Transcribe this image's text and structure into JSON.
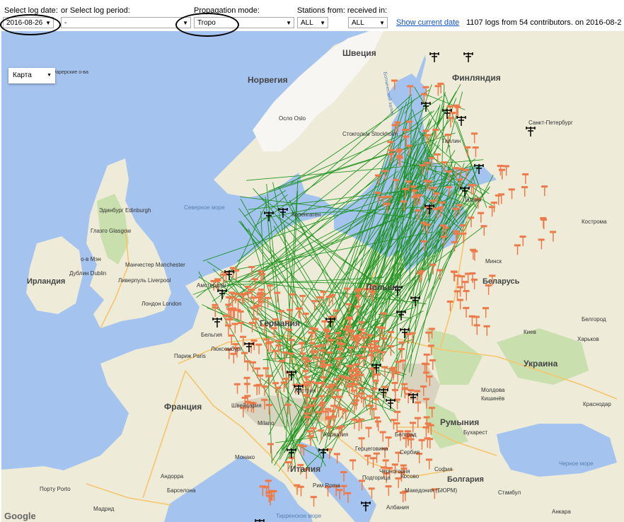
{
  "toolbar": {
    "log_date_label": "Select log date:",
    "log_date_value": "2016-08-26",
    "log_period_label": "or Select log period:",
    "log_period_value": "-",
    "prop_mode_label": "Propagation mode:",
    "prop_mode_value": "Tropo",
    "stations_label": "Stations from: received in:",
    "stations_from_value": "ALL",
    "received_in_value": "ALL",
    "show_current_label": "Show current date",
    "summary": "1107 logs from 54 contributors.   on 2016-08-2"
  },
  "map": {
    "type_label": "Карта",
    "attribution": "Google",
    "colors": {
      "sea": "#a4c3ee",
      "land": "#eeecd9",
      "snow": "#f7f6f2",
      "green": "#c9dfae",
      "path": "#0f8c0f",
      "fm": "#ee7a4a",
      "antenna": "#000000"
    },
    "place_labels": [
      {
        "name": "Швеция",
        "big": true
      },
      {
        "name": "Норвегия",
        "big": true
      },
      {
        "name": "Финляндия",
        "big": true
      },
      {
        "name": "Фарерские о-ва",
        "big": false
      },
      {
        "name": "Осло Oslo",
        "big": false
      },
      {
        "name": "Стокгольм Stockholm",
        "big": false
      },
      {
        "name": "Санкт-Петербург",
        "big": false
      },
      {
        "name": "Таллин",
        "big": false
      },
      {
        "name": "Северное море",
        "big": false
      },
      {
        "name": "Эдинбург Edinburgh",
        "big": false
      },
      {
        "name": "Глазго Glasgow",
        "big": false
      },
      {
        "name": "о-в Мэн",
        "big": false
      },
      {
        "name": "Ирландия",
        "big": true
      },
      {
        "name": "Дублин Dublin",
        "big": false
      },
      {
        "name": "Манчестер Manchester",
        "big": false
      },
      {
        "name": "Ливерпуль Liverpool",
        "big": false
      },
      {
        "name": "Лондон London",
        "big": false
      },
      {
        "name": "Копенгаген",
        "big": false
      },
      {
        "name": "Амстердам",
        "big": false
      },
      {
        "name": "Германия",
        "big": true
      },
      {
        "name": "Польша",
        "big": true
      },
      {
        "name": "Латвия",
        "big": false
      },
      {
        "name": "Минск",
        "big": false
      },
      {
        "name": "Беларусь",
        "big": true
      },
      {
        "name": "Бельгия",
        "big": false
      },
      {
        "name": "Париж Paris",
        "big": false
      },
      {
        "name": "Люксембург",
        "big": false
      },
      {
        "name": "Франция",
        "big": true
      },
      {
        "name": "Швейцария",
        "big": false
      },
      {
        "name": "Milano",
        "big": false
      },
      {
        "name": "Австрия",
        "big": false
      },
      {
        "name": "Киев",
        "big": false
      },
      {
        "name": "Харьков",
        "big": false
      },
      {
        "name": "Украина",
        "big": true
      },
      {
        "name": "Молдова",
        "big": false
      },
      {
        "name": "Кишинёв",
        "big": false
      },
      {
        "name": "Румыния",
        "big": true
      },
      {
        "name": "Бухарест",
        "big": false
      },
      {
        "name": "Хорватия",
        "big": false
      },
      {
        "name": "Белград",
        "big": false
      },
      {
        "name": "Сербия",
        "big": false
      },
      {
        "name": "Герцеговина",
        "big": false
      },
      {
        "name": "Монако",
        "big": false
      },
      {
        "name": "Италия",
        "big": true
      },
      {
        "name": "Черногория",
        "big": false
      },
      {
        "name": "Подгорица",
        "big": false
      },
      {
        "name": "Косово",
        "big": false
      },
      {
        "name": "София",
        "big": false
      },
      {
        "name": "Болгария",
        "big": true
      },
      {
        "name": "Македония (БЮРМ)",
        "big": false
      },
      {
        "name": "Рим Roma",
        "big": false
      },
      {
        "name": "Андорра",
        "big": false
      },
      {
        "name": "Барселона",
        "big": false
      },
      {
        "name": "Мадрид",
        "big": false
      },
      {
        "name": "Порту Porto",
        "big": false
      },
      {
        "name": "Тирренское море",
        "big": false
      },
      {
        "name": "Албания",
        "big": false
      },
      {
        "name": "Черное море",
        "big": false
      },
      {
        "name": "Стамбул",
        "big": false
      },
      {
        "name": "Анкара",
        "big": false
      },
      {
        "name": "Краснодар",
        "big": false
      },
      {
        "name": "Белгород",
        "big": false
      },
      {
        "name": "Кострома",
        "big": false
      },
      {
        "name": "Ботнический залив",
        "big": false
      }
    ]
  }
}
